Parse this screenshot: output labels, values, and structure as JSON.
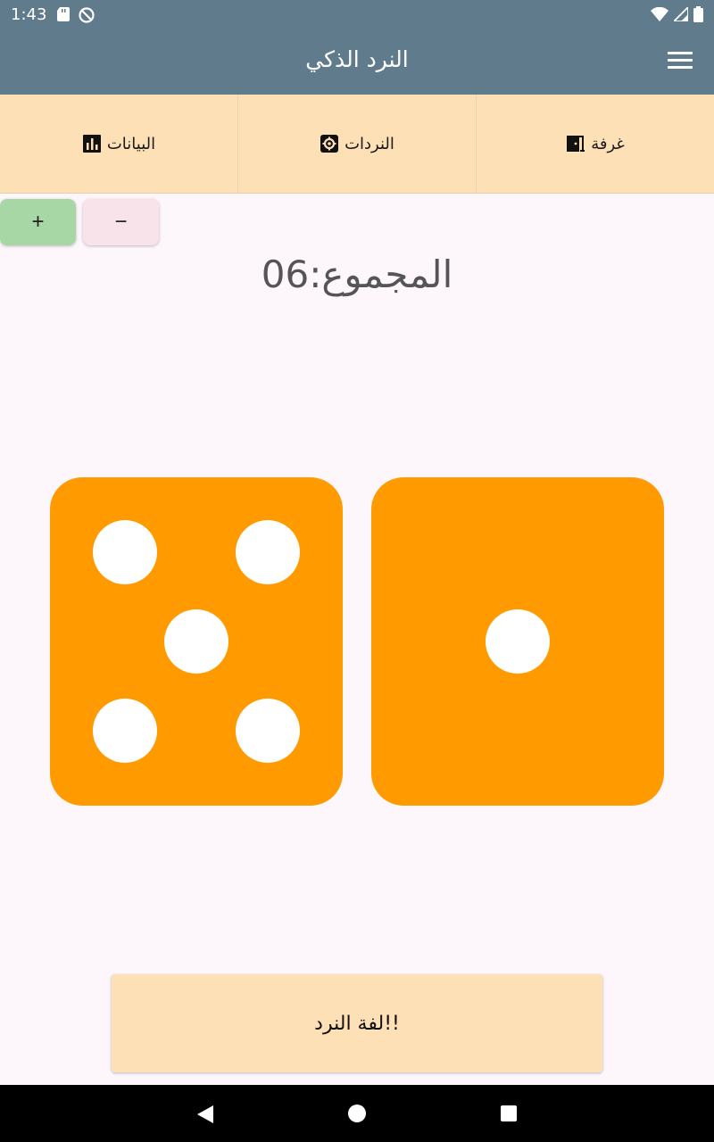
{
  "status_bar": {
    "time": "1:43",
    "left_icons": [
      "sd-card-icon",
      "no-sync-icon"
    ],
    "right_icons": [
      "wifi-icon",
      "signal-icon",
      "battery-icon"
    ]
  },
  "app_bar": {
    "title": "النرد الذكي",
    "menu_icon": "hamburger-menu-icon"
  },
  "tabs": [
    {
      "label": "غرفة",
      "icon": "door-icon"
    },
    {
      "label": "النردات",
      "icon": "dice-gear-icon"
    },
    {
      "label": "البيانات",
      "icon": "bar-chart-icon"
    }
  ],
  "controls": {
    "plus_label": "+",
    "minus_label": "−"
  },
  "total": {
    "text": "المجموع:06"
  },
  "dice": [
    {
      "value": 5,
      "color": "#ff9a00"
    },
    {
      "value": 1,
      "color": "#ff9a00"
    }
  ],
  "roll_button": {
    "label": "لفة النرد!!"
  },
  "colors": {
    "app_bar": "#607b8c",
    "tabs_bg": "#fee0b6",
    "die": "#ff9a00",
    "plus_bg": "#a8d7a6",
    "minus_bg": "#f8e3ea"
  }
}
